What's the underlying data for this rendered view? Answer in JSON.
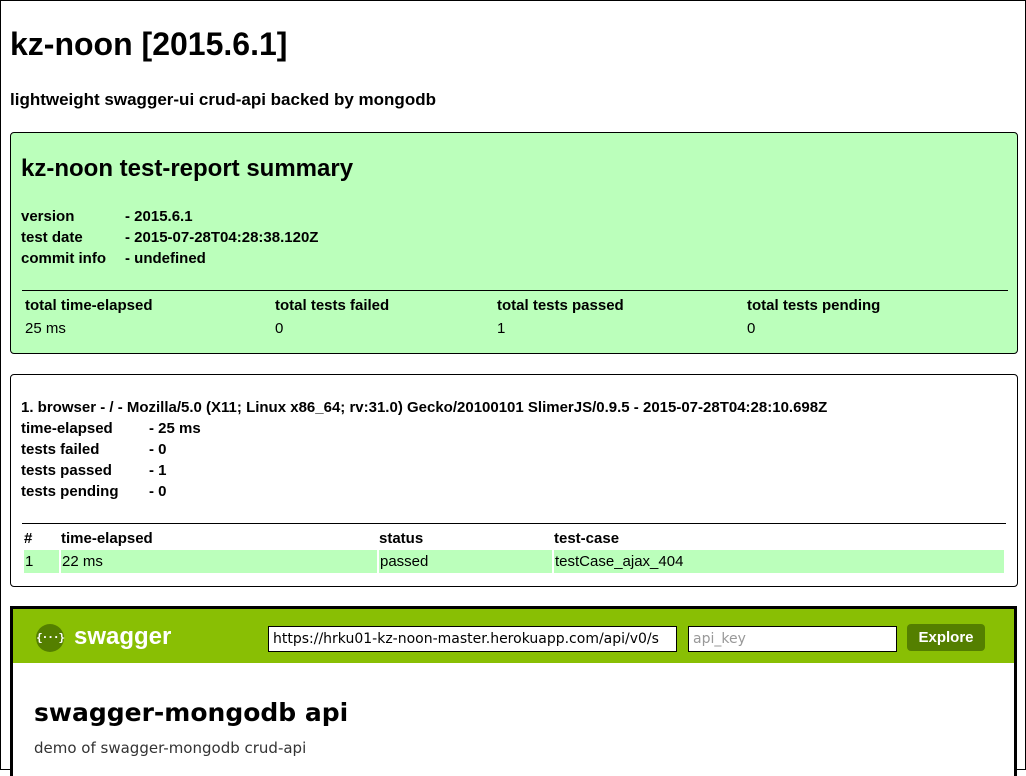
{
  "header": {
    "title": "kz-noon [2015.6.1]",
    "subtitle": "lightweight swagger-ui crud-api backed by mongodb"
  },
  "summary": {
    "title": "kz-noon test-report summary",
    "info": [
      {
        "label": "version",
        "value": "- 2015.6.1"
      },
      {
        "label": "test date",
        "value": "- 2015-07-28T04:28:38.120Z"
      },
      {
        "label": "commit info",
        "value": "- undefined"
      }
    ],
    "stats_headers": [
      "total time-elapsed",
      "total tests failed",
      "total tests passed",
      "total tests pending"
    ],
    "stats_values": [
      "25 ms",
      "0",
      "1",
      "0"
    ],
    "background_color": "#bbffbb"
  },
  "browser_report": {
    "heading": "1. browser - / - Mozilla/5.0 (X11; Linux x86_64; rv:31.0) Gecko/20100101 SlimerJS/0.9.5 - 2015-07-28T04:28:10.698Z",
    "info": [
      {
        "label": "time-elapsed",
        "value": "- 25 ms"
      },
      {
        "label": "tests failed",
        "value": "- 0"
      },
      {
        "label": "tests passed",
        "value": "- 1"
      },
      {
        "label": "tests pending",
        "value": "- 0"
      }
    ],
    "table_headers": [
      "#",
      "time-elapsed",
      "status",
      "test-case"
    ],
    "rows": [
      {
        "index": "1",
        "time_elapsed": "22 ms",
        "status": "passed",
        "test_case": "testCase_ajax_404"
      }
    ],
    "passed_row_color": "#bbffbb"
  },
  "swagger": {
    "logo_icon": "swagger-braces-icon",
    "logo_glyph": "{···}",
    "brand": "swagger",
    "url_value": "https://hrku01-kz-noon-master.herokuapp.com/api/v0/s",
    "api_key_placeholder": "api_key",
    "explore_label": "Explore",
    "api_title": "swagger-mongodb api",
    "api_description": "demo of swagger-mongodb crud-api",
    "header_color": "#89bf04",
    "button_color": "#547f00"
  }
}
